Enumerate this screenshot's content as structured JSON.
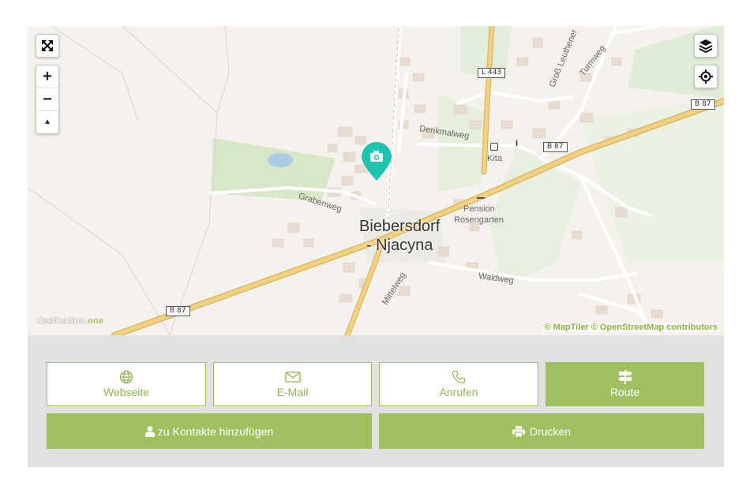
{
  "map": {
    "town_line1": "Biebersdorf",
    "town_line2": "- Njacyna",
    "streets": {
      "denkmalweg": "Denkmalweg",
      "grabenweg": "Grabenweg",
      "waldweg": "Waldweg",
      "mittelweg": "Mittelweg",
      "gross_leuthener": "Groß Leuthener",
      "turmweg": "Turmweg"
    },
    "pois": {
      "kita": "Kita",
      "pension_line1": "Pension",
      "pension_line2": "Rosengarten"
    },
    "road_shields": {
      "l443": "L 443",
      "b87_a": "B 87",
      "b87_b": "B 87",
      "b87_c": "B 87"
    },
    "attribution": "© MapTiler © OpenStreetMap contributors",
    "watermark_main": "destination.",
    "watermark_accent": "one",
    "marker_icon": "camera-icon"
  },
  "controls": {
    "fullscreen_icon": "expand-icon",
    "zoom_in": "+",
    "zoom_out": "−",
    "compass": "▲",
    "layers_icon": "layers-icon",
    "locate_icon": "crosshair-icon"
  },
  "buttons": {
    "website": "Webseite",
    "email": "E-Mail",
    "call": "Anrufen",
    "route": "Route",
    "add_contact": "zu Kontakte hinzufügen",
    "print": "Drucken"
  },
  "colors": {
    "accent": "#9fc15f",
    "marker": "#1fc4b0",
    "major_road": "#f3d27f"
  }
}
